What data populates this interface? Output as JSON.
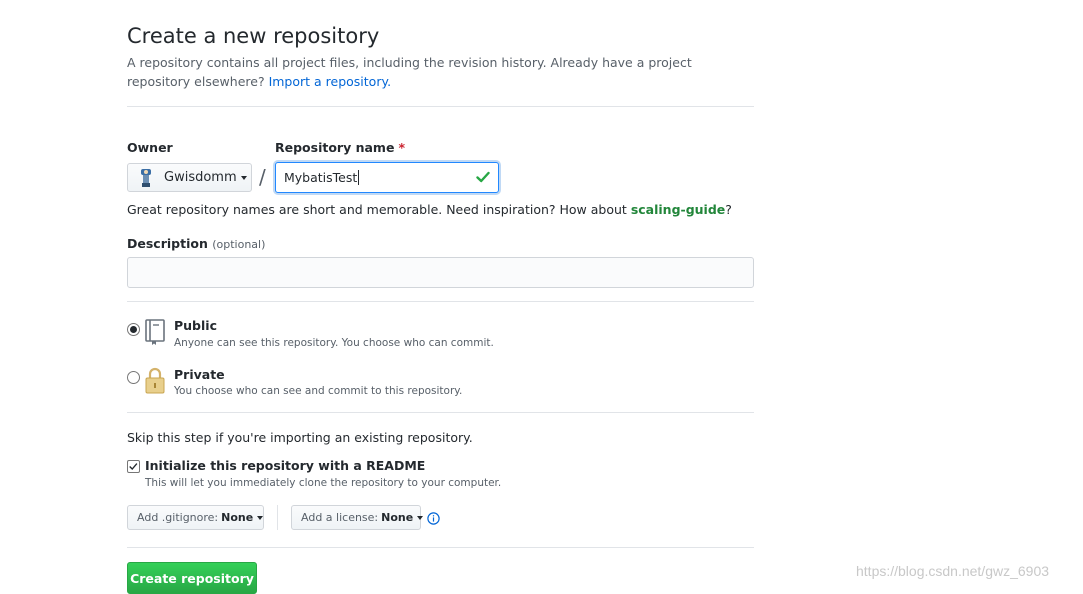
{
  "page": {
    "title": "Create a new repository",
    "subtitle": "A repository contains all project files, including the revision history. Already have a project repository elsewhere?",
    "import_link": "Import a repository."
  },
  "form": {
    "owner_label": "Owner",
    "owner_value": "Gwisdomm",
    "repo_name_label": "Repository name",
    "required_mark": "*",
    "slash": "/",
    "repo_name_value": "MybatisTest",
    "hint_prefix": "Great repository names are short and memorable. Need inspiration? How about",
    "hint_suggestion": "scaling-guide",
    "hint_suffix": "?",
    "description_label": "Description",
    "description_optional": "(optional)",
    "description_value": ""
  },
  "visibility": {
    "selected": "public",
    "options": [
      {
        "key": "public",
        "title": "Public",
        "note": "Anyone can see this repository. You choose who can commit."
      },
      {
        "key": "private",
        "title": "Private",
        "note": "You choose who can see and commit to this repository."
      }
    ]
  },
  "init": {
    "skip_text": "Skip this step if you're importing an existing repository.",
    "readme_label": "Initialize this repository with a README",
    "readme_note": "This will let you immediately clone the repository to your computer.",
    "readme_checked": true,
    "gitignore_prefix": "Add .gitignore:",
    "gitignore_value": "None",
    "license_prefix": "Add a license:",
    "license_value": "None"
  },
  "actions": {
    "create_label": "Create repository"
  },
  "watermark": "https://blog.csdn.net/gwz_6903",
  "colors": {
    "link": "#0366d6",
    "success": "#28a745",
    "suggestion": "#22863a",
    "required": "#cb2431"
  },
  "icons": {
    "owner_avatar": "avatar-icon",
    "public": "repo-book-icon",
    "private": "lock-icon",
    "valid": "check-icon",
    "info": "info-icon"
  }
}
